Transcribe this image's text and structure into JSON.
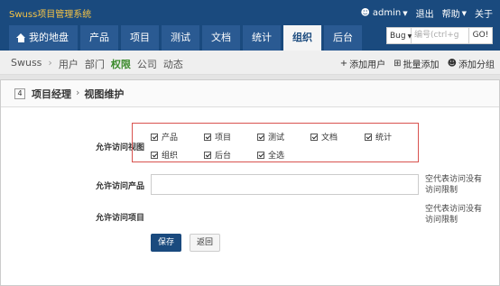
{
  "app": {
    "title": "Swuss项目管理系统"
  },
  "userbar": {
    "user": "admin",
    "logout": "退出",
    "help": "帮助",
    "about": "关于"
  },
  "nav": {
    "tabs": [
      "我的地盘",
      "产品",
      "项目",
      "测试",
      "文档",
      "统计",
      "组织",
      "后台"
    ],
    "active": "组织"
  },
  "search": {
    "type": "Bug",
    "placeholder": "编号(ctrl+g",
    "go": "GO!"
  },
  "subnav": {
    "root": "Swuss",
    "items": [
      "用户",
      "部门",
      "权限",
      "公司",
      "动态"
    ],
    "active": "权限",
    "actions": [
      "添加用户",
      "批量添加",
      "添加分组"
    ]
  },
  "panel": {
    "number": "4",
    "title": "项目经理",
    "subtitle": "视图维护"
  },
  "form": {
    "views_label": "允许访问视图",
    "views": [
      "产品",
      "项目",
      "测试",
      "文档",
      "统计",
      "组织",
      "后台",
      "全选"
    ],
    "products_label": "允许访问产品",
    "products_hint": "空代表访问没有访问限制",
    "projects_label": "允许访问项目",
    "projects_hint": "空代表访问没有访问限制",
    "save": "保存",
    "back": "返回"
  },
  "colors": {
    "header": "#1a4a7e",
    "brand": "#f7c445",
    "highlight": "#d9534f",
    "active_subnav": "#3a8a2a"
  }
}
